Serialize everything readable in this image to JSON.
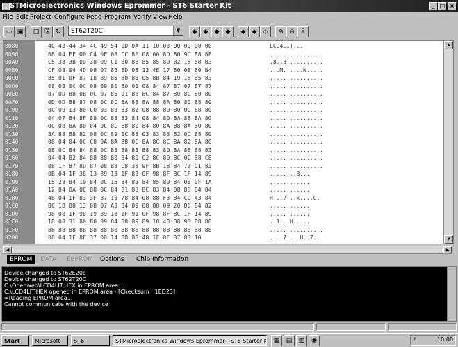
{
  "window": {
    "title": "STMicroelectronics Windows Eprommer - ST6 Starter Kit",
    "controls": [
      "_",
      "□",
      "×"
    ]
  },
  "menu": [
    "File",
    "Edit",
    "Project",
    "Configure",
    "Read",
    "Program",
    "Verify",
    "View",
    "Help"
  ],
  "toolbar": {
    "device": "ST62T20C"
  },
  "memory": {
    "rows": [
      {
        "addr": "0080",
        "hex": "4C 43 44 34 4C 49 54 0D 0A 11 10 03 00 00 00 00",
        "ascii": "LCD4LIT..."
      },
      {
        "addr": "0090",
        "hex": "08 04 FF 00 C4 0F 08 CC 8F 08 00 8D 80 9C 88 8F",
        "ascii": "................"
      },
      {
        "addr": "00A0",
        "hex": "C5 38 3B 0D 38 09 C1 80 88 85 85 80 B2 18 88 B3",
        "ascii": ".8..8..........."
      },
      {
        "addr": "00B0",
        "hex": "CF 08 04 4D 08 07 86 8D 08 13 4E 17 80 08 80 B4",
        "ascii": "...M......N....."
      },
      {
        "addr": "00C0",
        "hex": "85 01 0F 87 18 89 85 80 83 05 8B 84 19 18 85 83",
        "ascii": "................"
      },
      {
        "addr": "00D0",
        "hex": "08 03 0C 0C 08 09 80 80 01 08 84 87 87 07 87 87",
        "ascii": "................"
      },
      {
        "addr": "00E0",
        "hex": "07 0D 88 0B 0C 07 85 01 88 8C 84 87 80 8C 80 80",
        "ascii": "................"
      },
      {
        "addr": "00F0",
        "hex": "0D 0D 88 87 08 0C 8C 8A 88 8A 88 8A 80 80 88 80",
        "ascii": "................"
      },
      {
        "addr": "0100",
        "hex": "0C 09 13 80 C0 03 83 83 82 08 88 80 80 0C 88 80",
        "ascii": "................"
      },
      {
        "addr": "0110",
        "hex": "04 07 84 8F 88 0C 83 83 84 08 84 80 8A 88 8A 80",
        "ascii": "................"
      },
      {
        "addr": "0120",
        "hex": "0C 08 8A 80 04 0C 8C 88 80 84 80 8A 88 8A 80 80",
        "ascii": "................"
      },
      {
        "addr": "0130",
        "hex": "8A 88 88 82 08 0C 89 1C 88 03 83 83 82 0C 88 80",
        "ascii": "................"
      },
      {
        "addr": "0140",
        "hex": "08 04 04 0C C8 0A 8A 88 0C 8A 8C 8C 8A 82 8A 8C",
        "ascii": "................"
      },
      {
        "addr": "0150",
        "hex": "08 0C 84 84 88 0C 83 88 83 88 83 80 8A 88 88 83",
        "ascii": "................"
      },
      {
        "addr": "0160",
        "hex": "04 04 82 84 88 88 80 84 80 C2 8C 80 8C 0C 88 C8",
        "ascii": "................"
      },
      {
        "addr": "0170",
        "hex": "08 1F 87 8D 87 08 8B C8 38 9F 8B 18 84 73 C1 83",
        "ascii": "................"
      },
      {
        "addr": "0180",
        "hex": "0B 04 1F 38 13 89 13 1F 88 0F 98 8F 8C 1F 14 89",
        "ascii": "........8..."
      },
      {
        "addr": "0190",
        "hex": "15 28 84 10 84 0C 15 84 83 84 85 80 84 08 0F 1A",
        "ascii": "............"
      },
      {
        "addr": "01A0",
        "hex": "12 84 8A 0C 88 0C 84 81 88 8C 83 84 08 88 84 84",
        "ascii": "............"
      },
      {
        "addr": "01B0",
        "hex": "48 04 1F 83 3F 87 10 78 84 08 88 F3 84 C0 43 84",
        "ascii": "H...?...x....C."
      },
      {
        "addr": "01C0",
        "hex": "0C 1B 88 13 08 07 A3 84 89 08 88 09 20 80 84 82",
        "ascii": "............"
      },
      {
        "addr": "01D0",
        "hex": "98 08 1F 98 19 89 18 1F 91 0F 98 8F 8C 1F 14 89",
        "ascii": "............"
      },
      {
        "addr": "01E0",
        "hex": "18 08 31 80 80 09 84 88 89 89 18 48 88 98 88 88",
        "ascii": "..1...H....."
      },
      {
        "addr": "01F0",
        "hex": "88 88 88 88 88 88 88 88 88 88 88 88 88 88 88 88",
        "ascii": "................"
      },
      {
        "addr": "0200",
        "hex": "08 04 1F 8F 37 08 14 88 88 48 1F 8F 37 83 10",
        "ascii": "....7....H..7.."
      }
    ]
  },
  "tabs": [
    "EPROM",
    "DATA",
    "EEPROM",
    "Options",
    "Chip Information"
  ],
  "log": [
    "Device changed to ST62E20c",
    "Device changed to ST62T20C",
    "C:\\Openweb\\LCD4LIT.HEX in EPROM area...",
    "C:\\LCD4LIT.HEX opened in EPROM area - [Checksum : 1ED23]",
    "=Reading EPROM area...",
    "Cannot communicate with the device"
  ],
  "taskbar": {
    "start": "Start",
    "items": [
      "Microsoft",
      "ST6",
      "STMicroelectronics Windows Eprommer - ST6 Starter Kit"
    ],
    "clock": "10:08"
  }
}
